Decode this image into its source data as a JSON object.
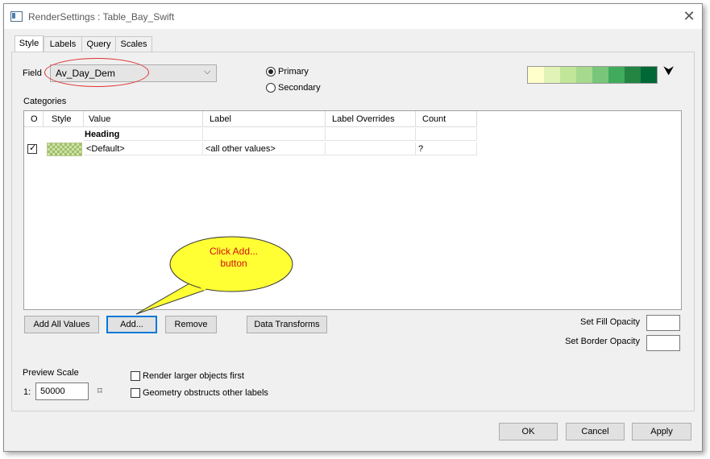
{
  "window": {
    "title": "RenderSettings : Table_Bay_Swift",
    "close_glyph": "✕"
  },
  "tabs": [
    {
      "label": "Style"
    },
    {
      "label": "Labels"
    },
    {
      "label": "Query"
    },
    {
      "label": "Scales"
    }
  ],
  "field": {
    "label": "Field",
    "value": "Av_Day_Dem"
  },
  "render_mode": {
    "primary": "Primary",
    "secondary": "Secondary",
    "selected": "Primary"
  },
  "color_ramp": {
    "colors": [
      "#ffffcc",
      "#e2f3b8",
      "#c2e699",
      "#a6d98e",
      "#78c679",
      "#41ab5d",
      "#238443",
      "#006837"
    ],
    "dropdown_glyph": "⮟"
  },
  "categories": {
    "label": "Categories",
    "columns": [
      "O",
      "Style",
      "Value",
      "Label",
      "Label Overrides",
      "Count"
    ],
    "heading_row": {
      "value": "Heading"
    },
    "rows": [
      {
        "checked": true,
        "value": "<Default>",
        "label": "<all other values>",
        "overrides": "",
        "count": "?"
      }
    ]
  },
  "callout": {
    "text": "Click Add... button"
  },
  "buttons": {
    "add_all": "Add All Values",
    "add": "Add...",
    "remove": "Remove",
    "data_transforms": "Data Transforms",
    "ok": "OK",
    "cancel": "Cancel",
    "apply": "Apply"
  },
  "opacity": {
    "fill_label": "Set Fill Opacity",
    "border_label": "Set Border Opacity",
    "fill_value": "",
    "border_value": ""
  },
  "preview": {
    "label": "Preview Scale",
    "prefix": "1:",
    "value": "50000",
    "sync_glyph": "⌑"
  },
  "options": {
    "render_larger": "Render larger objects first",
    "geometry_obstructs": "Geometry obstructs other labels"
  }
}
